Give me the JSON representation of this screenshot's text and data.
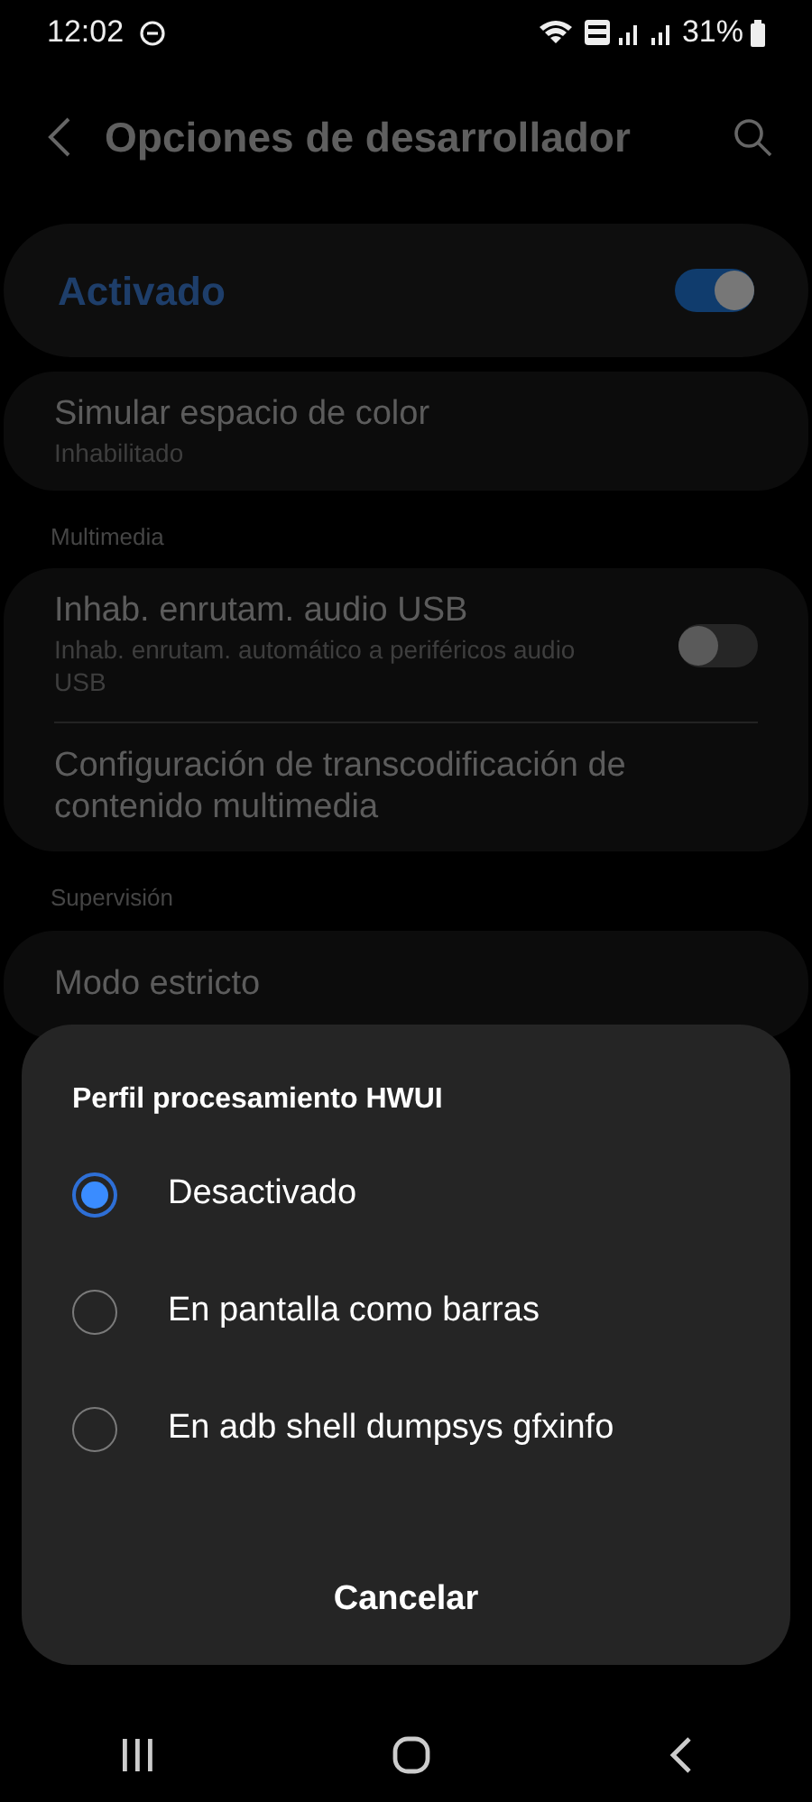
{
  "status_bar": {
    "time": "12:02",
    "battery": "31%"
  },
  "header": {
    "title": "Opciones de desarrollador"
  },
  "master_switch": {
    "label": "Activado",
    "on": true
  },
  "sections": [
    {
      "items": [
        {
          "kind": "plain",
          "title": "Simular espacio de color",
          "summary": "Inhabilitado"
        }
      ]
    },
    {
      "title": "Multimedia",
      "items": [
        {
          "kind": "switch",
          "title": "Inhab. enrutam. audio USB",
          "summary": "Inhab. enrutam. automático a periféricos audio USB",
          "on": false
        },
        {
          "kind": "plain",
          "title": "Configuración de transcodificación de contenido multimedia"
        }
      ]
    },
    {
      "title": "Supervisión",
      "items": [
        {
          "kind": "plain",
          "title": "Modo estricto"
        }
      ]
    }
  ],
  "dialog": {
    "title": "Perfil procesamiento HWUI",
    "options": [
      {
        "label": "Desactivado",
        "selected": true
      },
      {
        "label": "En pantalla como barras",
        "selected": false
      },
      {
        "label": "En adb shell dumpsys gfxinfo",
        "selected": false
      }
    ],
    "cancel": "Cancelar"
  }
}
